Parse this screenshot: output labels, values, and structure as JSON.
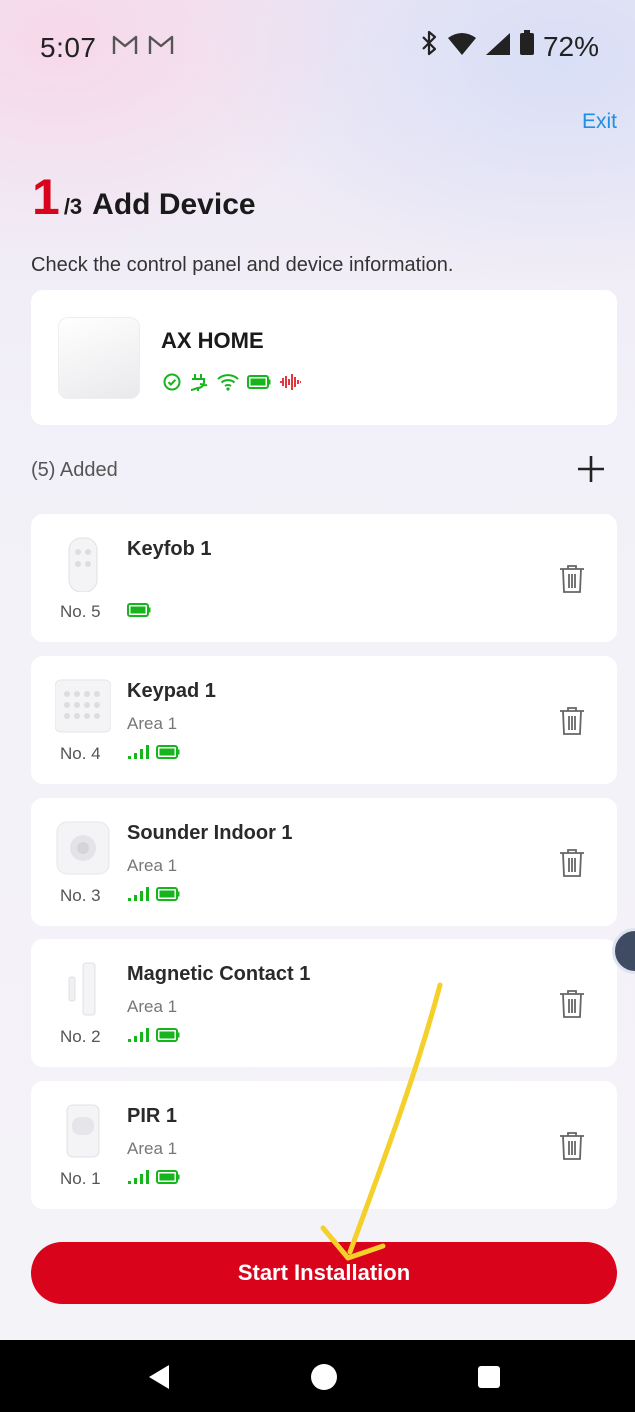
{
  "status_bar": {
    "time": "5:07",
    "mail_icons": [
      "gmail-icon",
      "gmail-icon"
    ],
    "battery": "72%"
  },
  "header": {
    "exit_label": "Exit",
    "step": "1",
    "step_total": "/3",
    "title": "Add Device",
    "subtitle": "Check the control panel and device information."
  },
  "control_panel": {
    "name": "AX HOME",
    "status_icons": [
      "check-circle-icon",
      "power-plug-icon",
      "wifi-icon",
      "battery-icon",
      "tamper-icon"
    ]
  },
  "added_section": {
    "label": "(5) Added"
  },
  "devices": [
    {
      "name": "Keyfob 1",
      "area": "",
      "number": "No. 5",
      "signal": false,
      "image": "keyfob"
    },
    {
      "name": "Keypad 1",
      "area": "Area 1",
      "number": "No. 4",
      "signal": true,
      "image": "keypad"
    },
    {
      "name": "Sounder Indoor 1",
      "area": "Area 1",
      "number": "No. 3",
      "signal": true,
      "image": "sounder"
    },
    {
      "name": "Magnetic Contact 1",
      "area": "Area 1",
      "number": "No. 2",
      "signal": true,
      "image": "contact"
    },
    {
      "name": "PIR 1",
      "area": "Area 1",
      "number": "No. 1",
      "signal": true,
      "image": "pir"
    }
  ],
  "start_button": {
    "label": "Start Installation"
  },
  "colors": {
    "brand_red": "#d9041c",
    "link_blue": "#1e8fe6",
    "status_green": "#16b51c",
    "annotation_yellow": "#f5cf2a"
  }
}
